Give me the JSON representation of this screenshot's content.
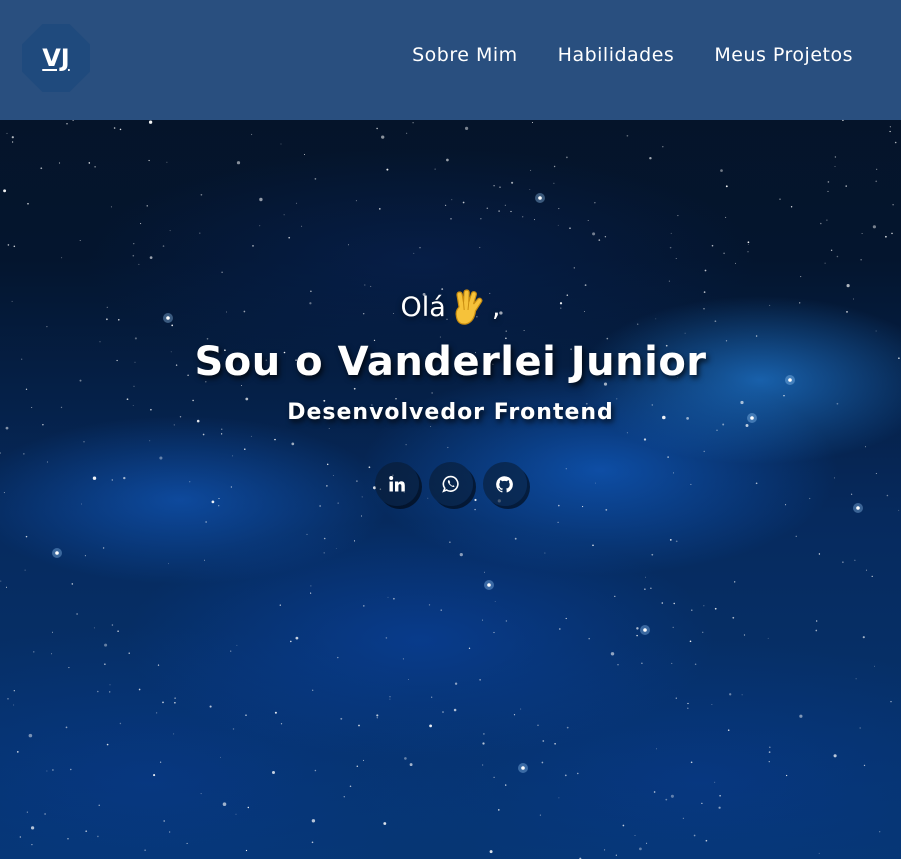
{
  "header": {
    "logo_text": "VJ",
    "nav": [
      {
        "label": "Sobre Mim"
      },
      {
        "label": "Habilidades"
      },
      {
        "label": "Meus Projetos"
      }
    ],
    "background_color": "#2d5587"
  },
  "hero": {
    "greeting_text": "Olá",
    "greeting_suffix": ",",
    "greeting_icon": "vulcan-salute-hand-icon",
    "headline": "Sou o Vanderlei Junior",
    "subtitle": "Desenvolvedor Frontend",
    "socials": [
      {
        "icon": "linkedin-icon"
      },
      {
        "icon": "whatsapp-icon"
      },
      {
        "icon": "github-icon"
      }
    ]
  },
  "colors": {
    "text": "#ffffff",
    "logo_bg": "#1f4a7d",
    "space_blue": "#063672"
  }
}
